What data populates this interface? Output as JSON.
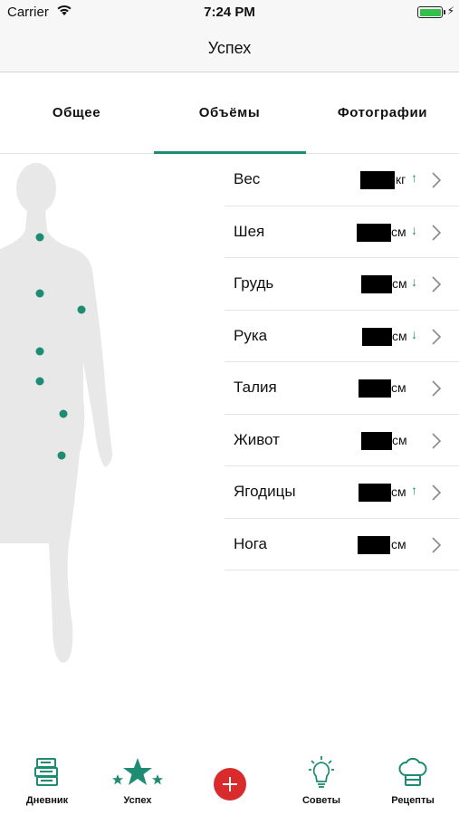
{
  "status_bar": {
    "carrier": "Carrier",
    "time": "7:24 PM",
    "battery_level": 1.0
  },
  "header": {
    "title": "Успех"
  },
  "tabs": [
    {
      "label": "Общее",
      "active": false
    },
    {
      "label": "Объёмы",
      "active": true
    },
    {
      "label": "Фотографии",
      "active": false
    }
  ],
  "measurements": [
    {
      "label": "Вес",
      "value": "",
      "unit": "кг",
      "trend": "↑"
    },
    {
      "label": "Шея",
      "value": "",
      "unit": "см",
      "trend": "↓"
    },
    {
      "label": "Грудь",
      "value": "",
      "unit": "см",
      "trend": "↓"
    },
    {
      "label": "Рука",
      "value": "",
      "unit": "см",
      "trend": "↓"
    },
    {
      "label": "Талия",
      "value": "",
      "unit": "см",
      "trend": ""
    },
    {
      "label": "Живот",
      "value": "",
      "unit": "см",
      "trend": ""
    },
    {
      "label": "Ягодицы",
      "value": "",
      "unit": "см",
      "trend": "↑"
    },
    {
      "label": "Нога",
      "value": "",
      "unit": "см",
      "trend": ""
    }
  ],
  "tab_bar": [
    {
      "label": "Дневник",
      "icon": "books-icon"
    },
    {
      "label": "Успех",
      "icon": "stars-icon",
      "active": true
    },
    {
      "label": "",
      "icon": "plus-icon"
    },
    {
      "label": "Советы",
      "icon": "lightbulb-icon"
    },
    {
      "label": "Рецепты",
      "icon": "chef-hat-icon"
    }
  ],
  "colors": {
    "accent": "#1d8c72",
    "add_button": "#d92b2b",
    "silhouette": "#e8e8e8"
  }
}
